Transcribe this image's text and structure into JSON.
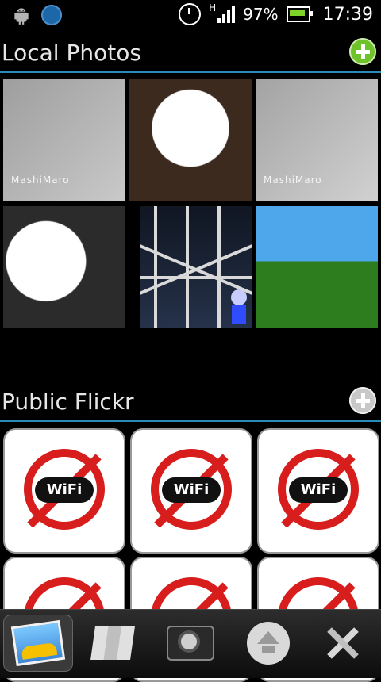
{
  "status_bar": {
    "network_type": "H",
    "battery": "97%",
    "time": "17:39",
    "icons": [
      "android-icon",
      "globe-icon",
      "alarm-icon",
      "signal-icon",
      "battery-icon"
    ]
  },
  "sections": {
    "local": {
      "title": "Local Photos"
    },
    "flickr": {
      "title": "Public Flickr"
    }
  },
  "local_photos": [
    {
      "label": "MashiMaro"
    },
    {
      "label": ""
    },
    {
      "label": "MashiMaro"
    },
    {
      "label": ""
    },
    {
      "label": ""
    },
    {
      "label": ""
    }
  ],
  "flickr_tiles": [
    {
      "text": "WiFi"
    },
    {
      "text": "WiFi"
    },
    {
      "text": "WiFi"
    },
    {
      "text": ""
    },
    {
      "text": ""
    },
    {
      "text": ""
    }
  ],
  "toolbar": {
    "items": [
      {
        "name": "gallery",
        "active": true
      },
      {
        "name": "map",
        "active": false
      },
      {
        "name": "camera",
        "active": false
      },
      {
        "name": "upload",
        "active": false
      },
      {
        "name": "settings",
        "active": false
      }
    ]
  },
  "colors": {
    "accent_rule": "#2b8bb8",
    "add_green": "#6ec32a"
  }
}
